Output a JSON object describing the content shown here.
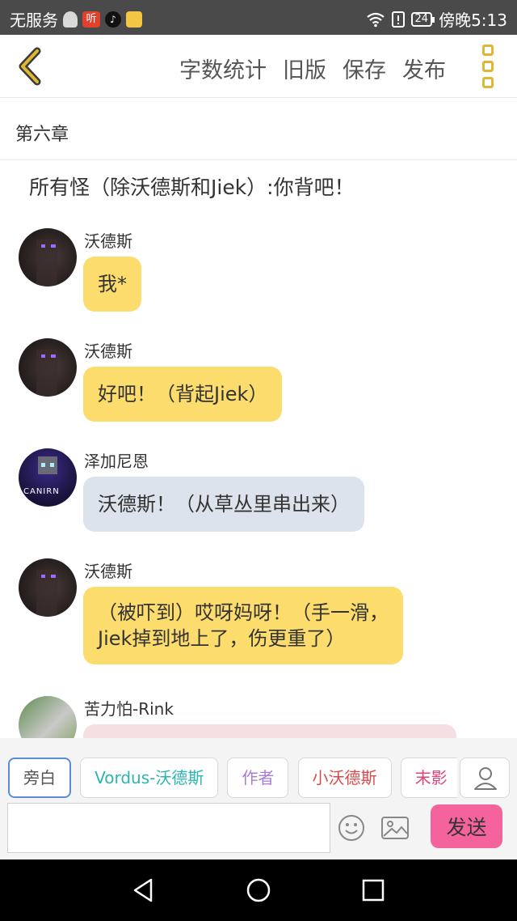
{
  "status_bar": {
    "carrier": "无服务",
    "listen_icon_text": "听",
    "battery": "24",
    "time": "傍晚5:13"
  },
  "header": {
    "actions": [
      "字数统计",
      "旧版",
      "保存",
      "发布"
    ],
    "accent_color": "#e0b733"
  },
  "chapter": {
    "title": "第六章"
  },
  "narration": "所有怪（除沃德斯和Jiek）:你背吧！",
  "messages": [
    {
      "name": "沃德斯",
      "text": "我*",
      "bubble_color": "yellow",
      "avatar": "dark-enderman"
    },
    {
      "name": "沃德斯",
      "text": "好吧！（背起Jiek）",
      "bubble_color": "yellow",
      "avatar": "dark-enderman"
    },
    {
      "name": "泽加尼恩",
      "text": "沃德斯！（从草丛里串出来）",
      "bubble_color": "blue",
      "avatar": "robot",
      "avatar_text": "CANIRN"
    },
    {
      "name": "沃德斯",
      "text": [
        "（被吓到）哎呀妈呀！（手一滑，",
        "Jiek掉到地上了，伤更重了）"
      ],
      "bubble_color": "yellow",
      "avatar": "dark-enderman"
    },
    {
      "name": "苦力怕-Rink",
      "text": "",
      "bubble_color": "pink",
      "avatar": "creeper"
    }
  ],
  "bottom_bar": {
    "role_chips": [
      "旁白",
      "Vordus-沃德斯",
      "作者",
      "小沃德斯",
      "末影"
    ],
    "input_placeholder": "",
    "send_label": "发送",
    "send_color": "#f4639c"
  }
}
